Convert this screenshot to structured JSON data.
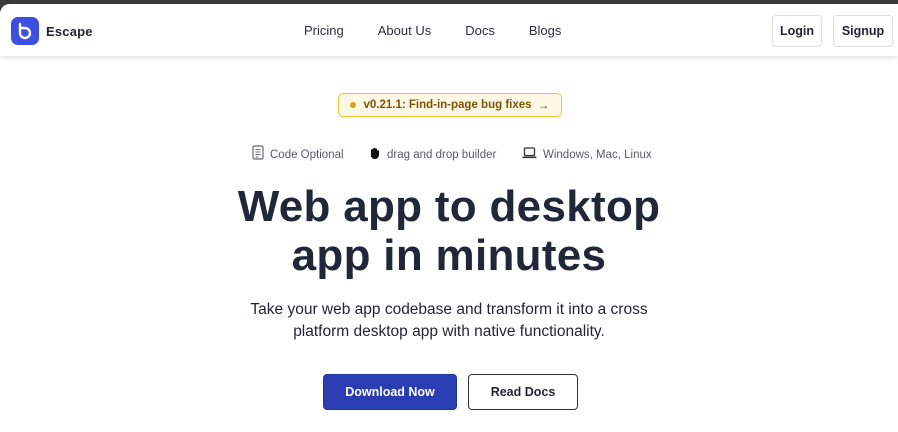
{
  "brand": {
    "name": "Escape",
    "accent": "#3c4fe0"
  },
  "nav": {
    "links": [
      "Pricing",
      "About Us",
      "Docs",
      "Blogs"
    ],
    "login_label": "Login",
    "signup_label": "Signup"
  },
  "hero": {
    "badge_text": "v0.21.1: Find-in-page bug fixes",
    "badge_icon": "arrow-right-icon",
    "features": [
      {
        "icon": "document-icon",
        "label": "Code Optional"
      },
      {
        "icon": "hand-icon",
        "label": "drag and drop builder"
      },
      {
        "icon": "laptop-icon",
        "label": "Windows, Mac, Linux"
      }
    ],
    "headline_line1": "Web app to desktop",
    "headline_line2": "app in minutes",
    "subtitle_line1": "Take your web app codebase and transform it into a cross",
    "subtitle_line2": "platform desktop app with native functionality.",
    "primary_cta": "Download Now",
    "secondary_cta": "Read Docs",
    "primary_color": "#2a3db3",
    "badge_color": "#f1c232"
  }
}
